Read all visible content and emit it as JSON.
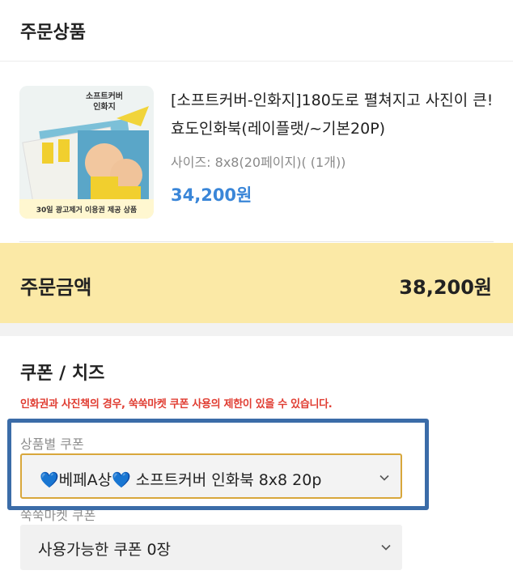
{
  "header": {
    "title": "주문상품"
  },
  "product": {
    "name": "[소프트커버-인화지]180도로 펼쳐지고 사진이 큰! 효도인화북(레이플랫/~기본20P)",
    "option": "사이즈: 8x8(20페이지)( (1개))",
    "price": "34,200원",
    "thumbnail": {
      "title_line1": "소프트커버",
      "title_line2": "인화지",
      "banner": "30일 광고제거 이용권 제공 상품"
    }
  },
  "order_total": {
    "label": "주문금액",
    "amount": "38,200원"
  },
  "coupon": {
    "title": "쿠폰 / 치즈",
    "warning": "인화권과 사진책의 경우, 쑥쑥마켓 쿠폰 사용의 제한이 있을 수 있습니다.",
    "product_coupon_label": "상품별 쿠폰",
    "product_coupon_value": "💙베페A상💙 소프트커버 인화북 8x8 20p",
    "market_coupon_label": "쑥쑥마켓 쿠폰",
    "market_coupon_value": "사용가능한 쿠폰 0장"
  },
  "colors": {
    "accent_price": "#3a86d8",
    "total_background": "#fbe9a6",
    "warning": "#e03c31",
    "focus_border": "#d8a73b",
    "highlight_box": "#3b6ca8"
  }
}
